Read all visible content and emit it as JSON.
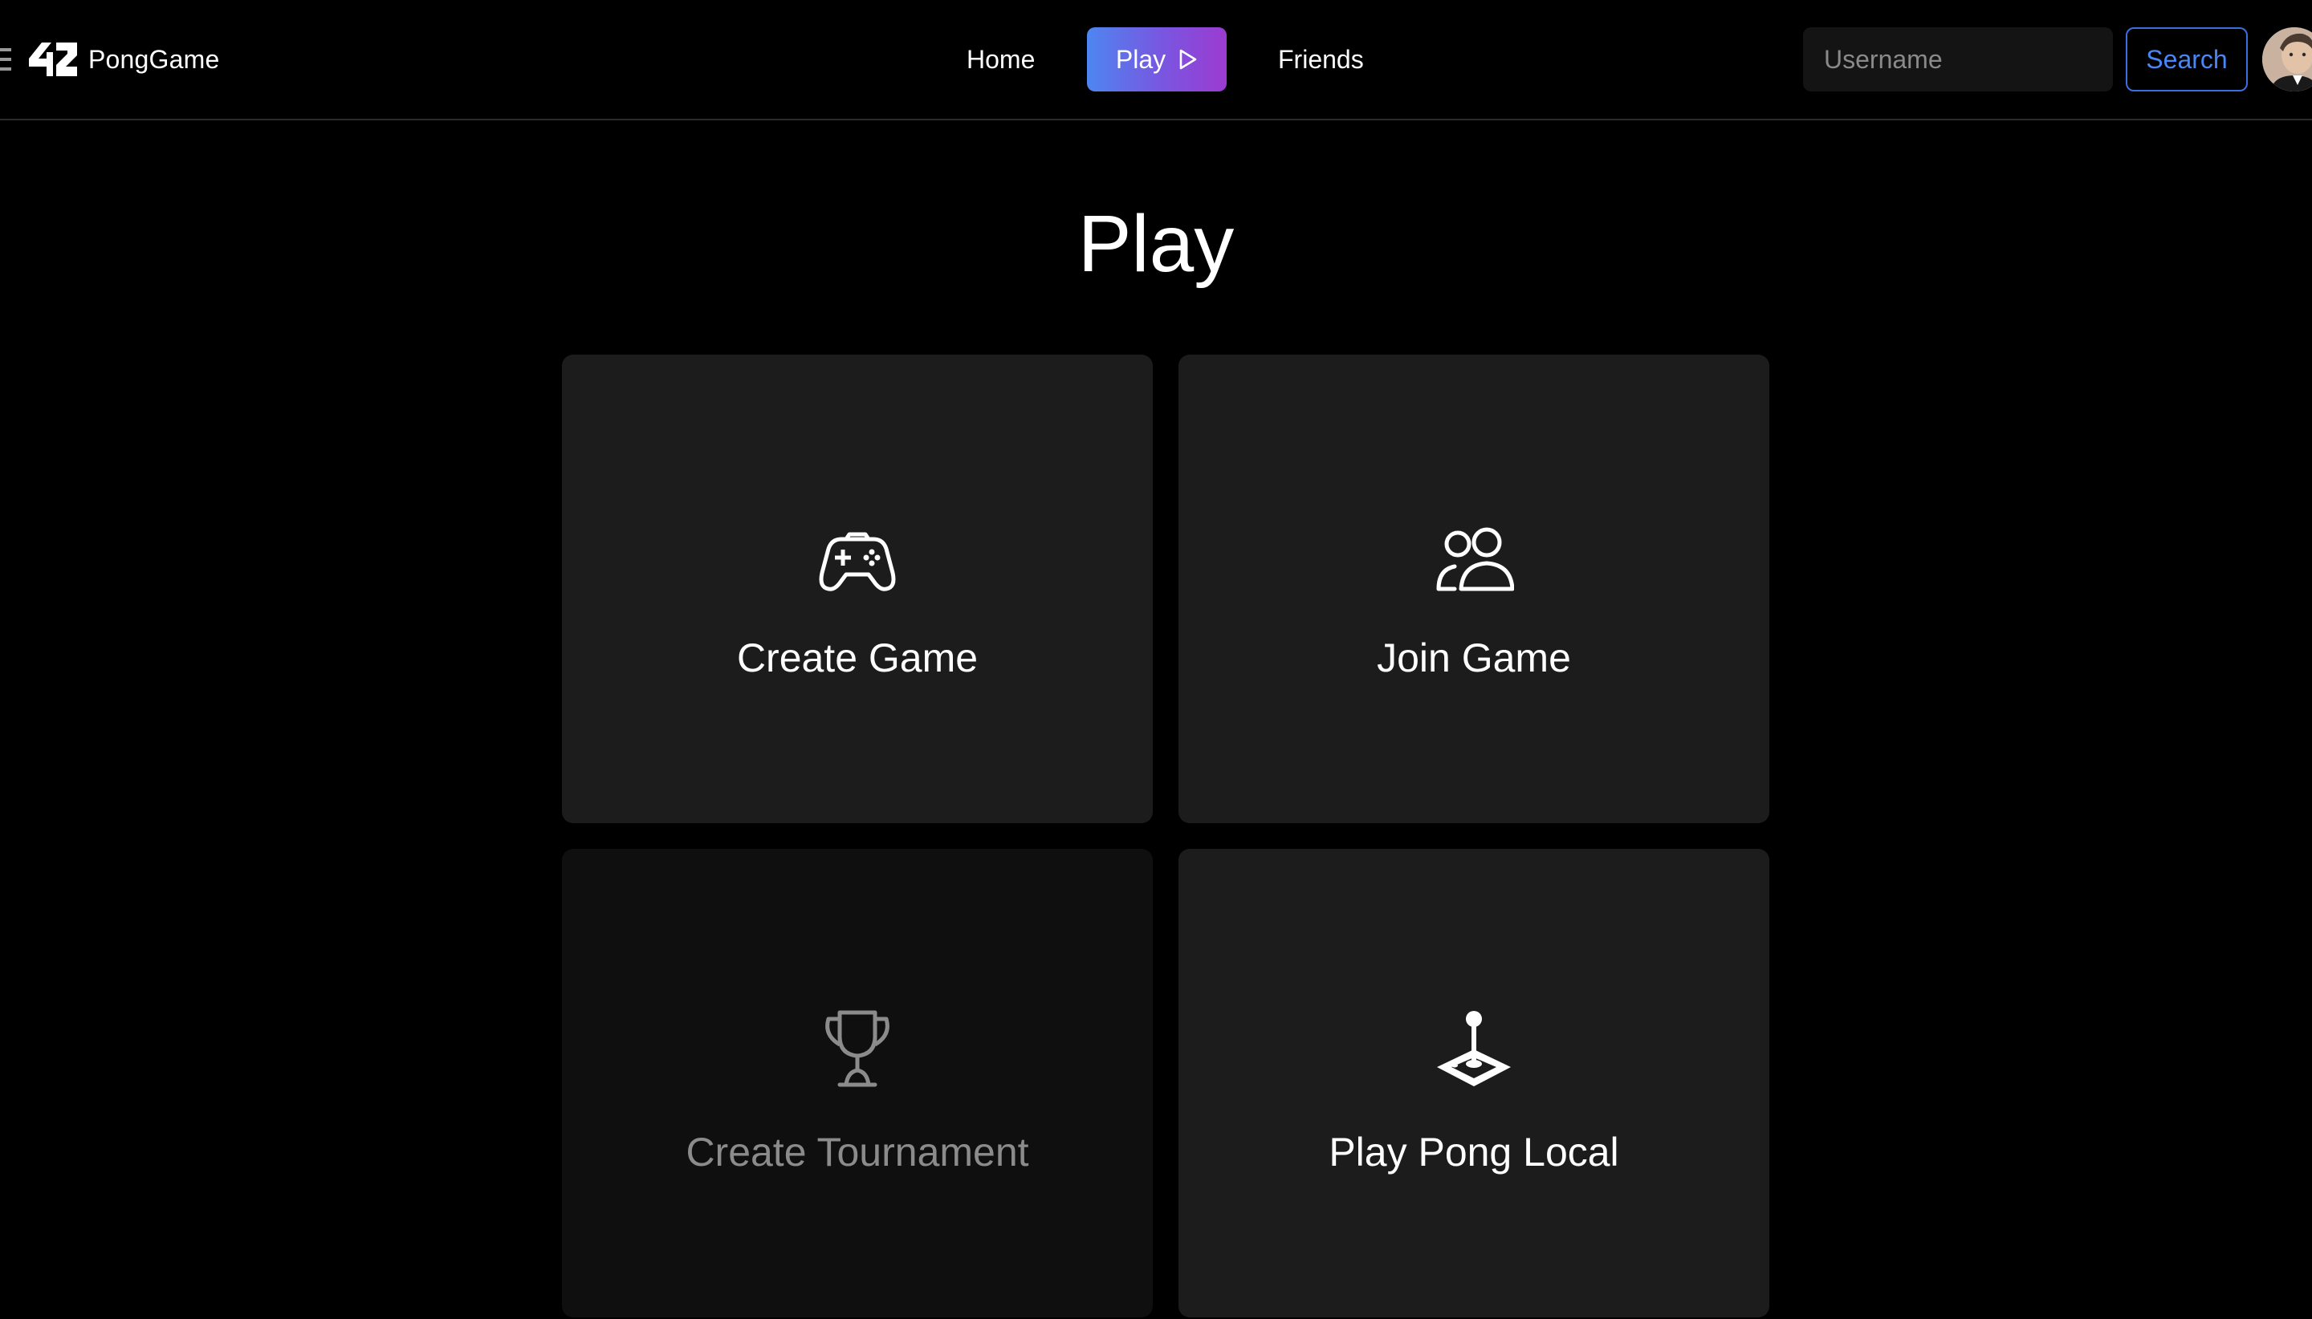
{
  "header": {
    "brand_logo_text": "42",
    "brand_name": "PongGame",
    "nav": {
      "home": "Home",
      "play": "Play",
      "friends": "Friends"
    },
    "search": {
      "placeholder": "Username",
      "value": "",
      "button_label": "Search"
    }
  },
  "main": {
    "title": "Play",
    "cards": [
      {
        "label": "Create Game",
        "icon": "gamepad-icon",
        "enabled": true
      },
      {
        "label": "Join Game",
        "icon": "users-icon",
        "enabled": true
      },
      {
        "label": "Create Tournament",
        "icon": "trophy-icon",
        "enabled": false
      },
      {
        "label": "Play Pong Local",
        "icon": "joystick-icon",
        "enabled": true
      }
    ]
  },
  "colors": {
    "background": "#000000",
    "card": "#1c1c1c",
    "card_disabled": "#0f0f0f",
    "play_gradient_start": "#4d86f0",
    "play_gradient_end": "#9c3bd0",
    "search_accent": "#3b6fe0",
    "disabled_text": "#8b8b8b"
  }
}
